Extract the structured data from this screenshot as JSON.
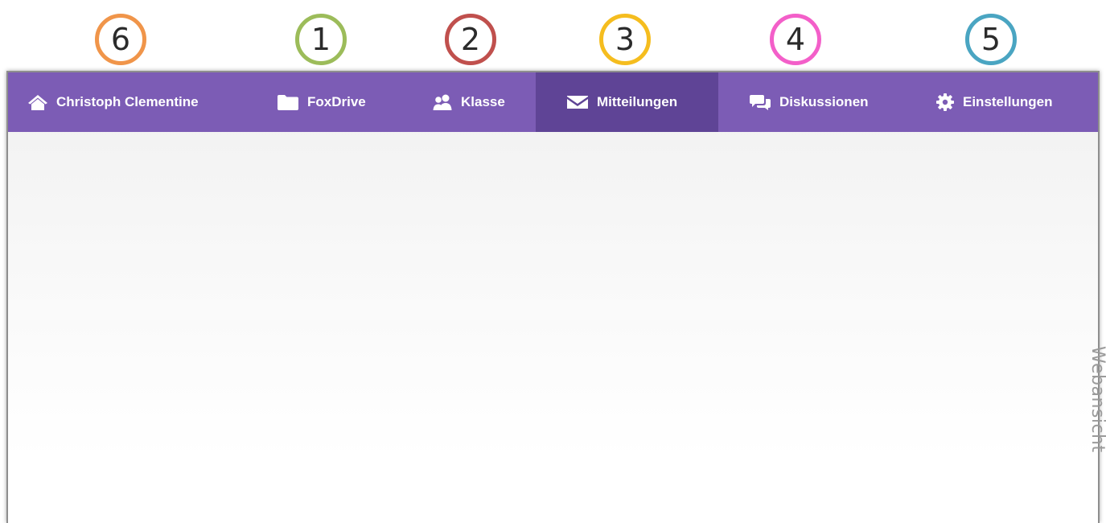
{
  "callouts": [
    {
      "number": "6",
      "color": "#f0954a",
      "target": "home"
    },
    {
      "number": "1",
      "color": "#9cbc5a",
      "target": "foxdrive"
    },
    {
      "number": "2",
      "color": "#c0504d",
      "target": "klasse"
    },
    {
      "number": "3",
      "color": "#f5bd1f",
      "target": "mitteilungen"
    },
    {
      "number": "4",
      "color": "#f35fc9",
      "target": "diskussionen"
    },
    {
      "number": "5",
      "color": "#4aa5c2",
      "target": "einstellungen"
    }
  ],
  "navbar": {
    "background": "#7c5cb5",
    "active_background": "#5f4496",
    "items": [
      {
        "label": "Christoph Clementine",
        "icon": "home-icon",
        "active": false
      },
      {
        "label": "FoxDrive",
        "icon": "folder-icon",
        "active": false
      },
      {
        "label": "Klasse",
        "icon": "users-icon",
        "active": false
      },
      {
        "label": "Mitteilungen",
        "icon": "envelope-icon",
        "active": true
      },
      {
        "label": "Diskussionen",
        "icon": "chat-icon",
        "active": false
      },
      {
        "label": "Einstellungen",
        "icon": "gear-icon",
        "active": false
      }
    ]
  },
  "side_label": "Webansicht"
}
